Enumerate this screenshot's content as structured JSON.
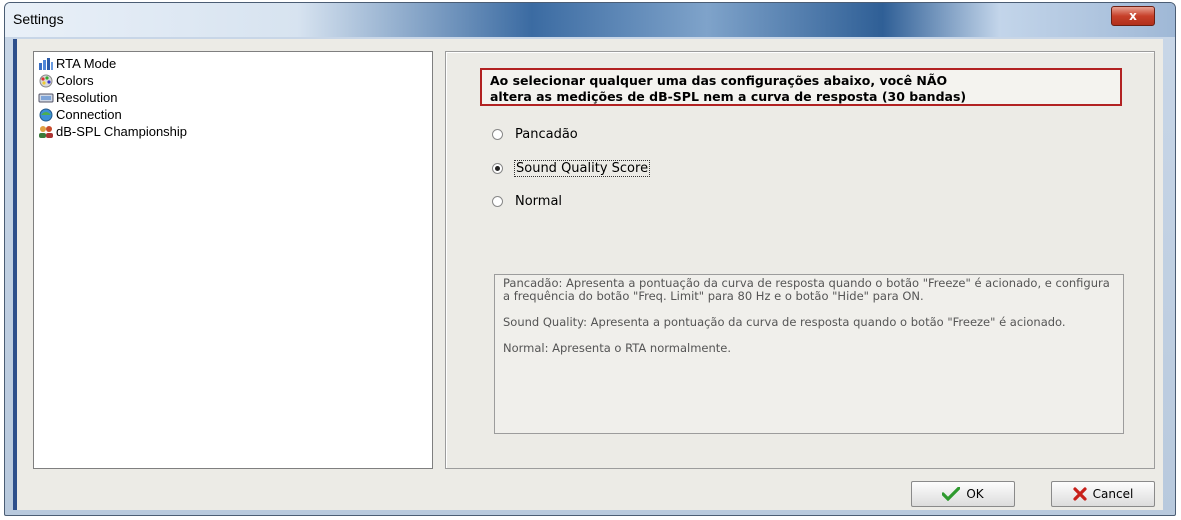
{
  "window": {
    "title": "Settings"
  },
  "title_controls": {
    "close_glyph": "x"
  },
  "tree": {
    "items": [
      {
        "label": "RTA Mode",
        "icon": "rta-mode-icon"
      },
      {
        "label": "Colors",
        "icon": "colors-icon"
      },
      {
        "label": "Resolution",
        "icon": "resolution-icon"
      },
      {
        "label": "Connection",
        "icon": "connection-icon"
      },
      {
        "label": "dB-SPL Championship",
        "icon": "championship-icon"
      }
    ]
  },
  "notice": {
    "line1": "Ao selecionar qualquer uma das configurações abaixo, você NÃO",
    "line2": "altera as medições de dB-SPL nem a curva de resposta (30 bandas)"
  },
  "options": [
    {
      "label": "Pancadão",
      "checked": false
    },
    {
      "label": "Sound Quality Score",
      "checked": true
    },
    {
      "label": "Normal",
      "checked": false
    }
  ],
  "description": "Pancadão: Apresenta a pontuação da curva de resposta quando o botão \"Freeze\" é acionado, e configura a frequência do botão \"Freq. Limit\" para 80 Hz e o botão \"Hide\" para ON.\n\nSound Quality: Apresenta a pontuação da curva de resposta quando o botão \"Freeze\" é acionado.\n\nNormal: Apresenta o RTA normalmente.",
  "buttons": {
    "ok": "OK",
    "cancel": "Cancel"
  },
  "colors": {
    "notice_border": "#b22222",
    "ok_check": "#2e9a2e",
    "cancel_x": "#c8201a"
  }
}
